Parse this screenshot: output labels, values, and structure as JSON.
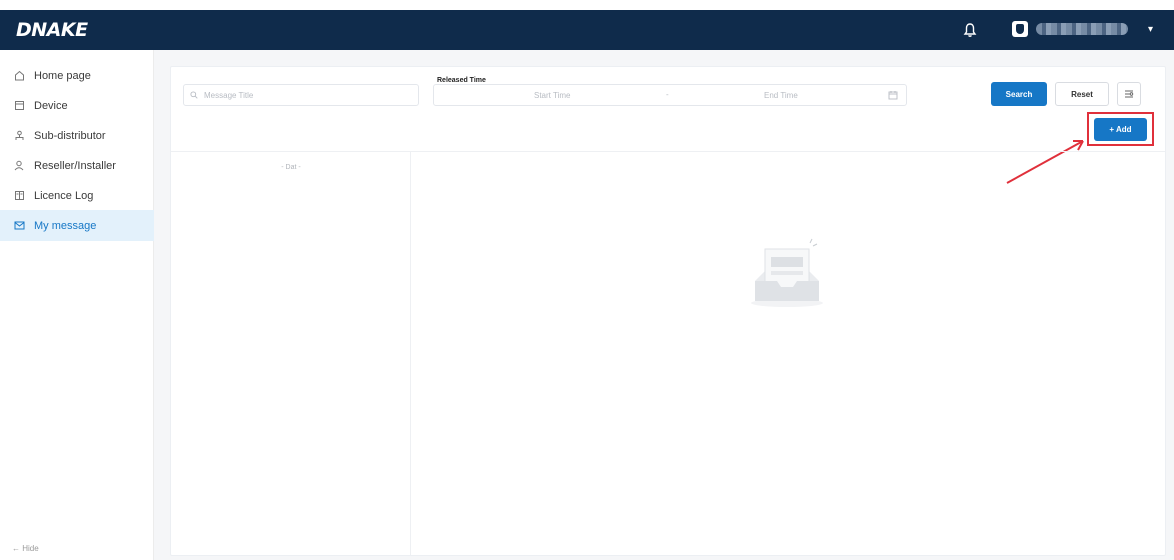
{
  "header": {
    "logo": "DNAKE",
    "notifications_icon": "bell-icon",
    "user_icon": "avatar-icon"
  },
  "sidebar": {
    "items": [
      {
        "label": "Home page",
        "icon": "home-icon",
        "active": false
      },
      {
        "label": "Device",
        "icon": "device-icon",
        "active": false
      },
      {
        "label": "Sub-distributor",
        "icon": "user-tree-icon",
        "active": false
      },
      {
        "label": "Reseller/Installer",
        "icon": "user-icon",
        "active": false
      },
      {
        "label": "Licence Log",
        "icon": "log-icon",
        "active": false
      },
      {
        "label": "My message",
        "icon": "mail-icon",
        "active": true
      }
    ],
    "hide_label": "Hide"
  },
  "filters": {
    "title_placeholder": "Message Title",
    "date_label": "Released Time",
    "start_placeholder": "Start Time",
    "range_separator": "-",
    "end_placeholder": "End Time",
    "search_label": "Search",
    "reset_label": "Reset"
  },
  "actions": {
    "add_label": "+ Add"
  },
  "list": {
    "empty_text": "- Dat -"
  },
  "colors": {
    "topbar": "#0f2b4b",
    "primary": "#1677c6",
    "active_bg": "#e3f1fb",
    "highlight": "#e0303b"
  }
}
